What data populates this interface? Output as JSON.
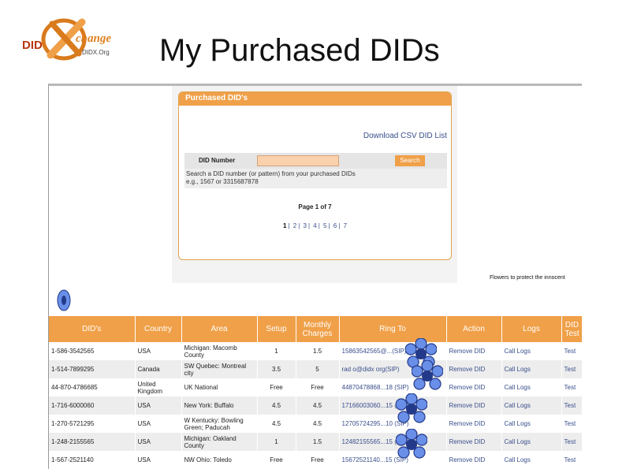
{
  "slide": {
    "title": "My Purchased DIDs",
    "logo": {
      "main": "DID",
      "script": "change",
      "sub": "DIDX.Org"
    }
  },
  "panel": {
    "header": "Purchased DID's",
    "csv_link": "Download CSV DID List",
    "search_label": "DID Number",
    "search_value": "",
    "search_button": "Search",
    "hint_line1": "Search a DID number (or pattern) from your purchased DIDs",
    "hint_line2": "e.g., 1567 or 3315687878",
    "page_info": "Page 1 of 7",
    "pages": [
      "1",
      "2",
      "3",
      "4",
      "5",
      "6",
      "7"
    ]
  },
  "flowers_note": "Flowers to protect the innocent",
  "table": {
    "headers": [
      "DID's",
      "Country",
      "Area",
      "Setup",
      "Monthly Charges",
      "Ring To",
      "Action",
      "Logs",
      "DID Test"
    ],
    "rows": [
      [
        "1-586-3542565",
        "USA",
        "Michigan: Macomb County",
        "1",
        "1.5",
        "15863542565@...(SIP)",
        "Remove DID",
        "Call Logs",
        "Test"
      ],
      [
        "1-514-7899295",
        "Canada",
        "SW Quebec: Montreal city",
        "3.5",
        "5",
        "rad o@didx org(SIP)",
        "Remove DID",
        "Call Logs",
        "Test"
      ],
      [
        "44-870-4786685",
        "United Kingdom",
        "UK National",
        "Free",
        "Free",
        "44870478868...18 (SIP)",
        "Remove DID",
        "Call Logs",
        "Test"
      ],
      [
        "1-716-6000060",
        "USA",
        "New York: Buffalo",
        "4.5",
        "4.5",
        "17166003060...15 (SIP)",
        "Remove DID",
        "Call Logs",
        "Test"
      ],
      [
        "1-270-5721295",
        "USA",
        "W Kentucky: Bowling Green; Paducah",
        "4.5",
        "4.5",
        "12705724295...10 (SIP)",
        "Remove DID",
        "Call Logs",
        "Test"
      ],
      [
        "1-248-2155565",
        "USA",
        "Michigan: Oakland County",
        "1",
        "1.5",
        "12482155565...15 (SIP)",
        "Remove DID",
        "Call Logs",
        "Test"
      ],
      [
        "1-567-2521140",
        "USA",
        "NW Ohio: Toledo",
        "Free",
        "Free",
        "15672521140...15 (SIP)",
        "Remove DID",
        "Call Logs",
        "Test"
      ]
    ]
  },
  "colors": {
    "accent": "#f0a048",
    "link": "#3a4f8c",
    "flower": "#6a8fe8"
  }
}
